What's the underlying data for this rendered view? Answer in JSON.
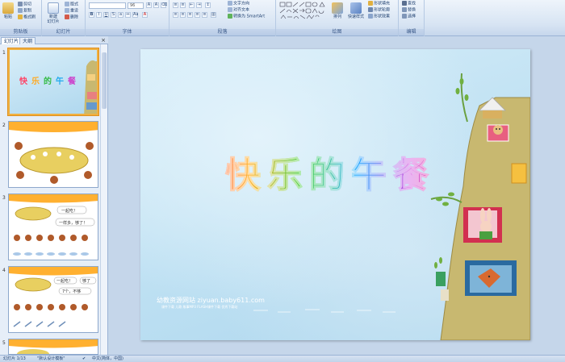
{
  "ribbon": {
    "groups": {
      "clipboard": "剪贴板",
      "slides": "幻灯片",
      "font": "字体",
      "paragraph": "段落",
      "drawing": "绘图",
      "editing": "编辑"
    },
    "clipboard": {
      "paste": "粘贴",
      "cut": "剪切",
      "copy": "复制",
      "format_painter": "格式刷"
    },
    "slides": {
      "new_slide": "新建",
      "new_slide_2": "幻灯片",
      "layout": "版式",
      "reset": "重设",
      "delete": "删除"
    },
    "font": {
      "font_size": "96"
    },
    "paragraph": {
      "text_direction": "文字方向",
      "align_text": "对齐文本",
      "smartart": "转换为 SmartArt"
    },
    "drawing": {
      "arrange": "排列",
      "quick_styles": "快速样式",
      "shape_fill": "形状填充",
      "shape_outline": "形状轮廓",
      "shape_effects": "形状效果"
    },
    "editing": {
      "find": "查找",
      "replace": "替换",
      "select": "选择"
    }
  },
  "left_panel": {
    "tabs": [
      "幻灯片",
      "大纲"
    ],
    "close": "×",
    "slides": [
      {
        "num": "1",
        "selected": true
      },
      {
        "num": "2"
      },
      {
        "num": "3"
      },
      {
        "num": "4"
      },
      {
        "num": "5"
      }
    ],
    "thumb3_bubble1": "一起吃！",
    "thumb3_bubble2": "一样多，够了！",
    "thumb4_bubble1": "一起吃！",
    "thumb4_bubble2": "够了",
    "thumb4_bubble3": "7个，不够"
  },
  "slide": {
    "title": "快乐的午餐",
    "site_line1": "幼教资源网站  ziyuan.baby611.com",
    "site_line2": "课件下载  儿歌  故事MP3  FLASH课件下载  优秀下载站"
  },
  "statusbar": {
    "slide_index": "幻灯片 1/13",
    "theme": "\"默认设计模板\"",
    "language": "中文(简体，中国)"
  },
  "colors": {
    "ribbon_bg": "#d7e4f3",
    "slide_bg": "#bfe1f3",
    "selection": "#f0b040",
    "tree": "#c8b870"
  }
}
